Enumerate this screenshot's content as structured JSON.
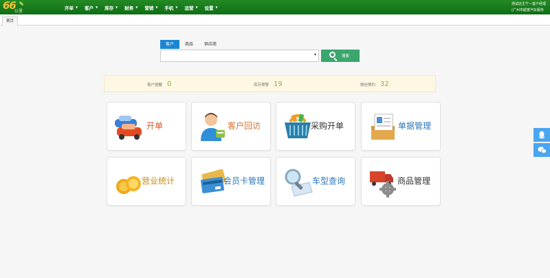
{
  "app": {
    "logo_text": "66",
    "logo_sub": "公里"
  },
  "nav": [
    {
      "label": "开单"
    },
    {
      "label": "客户"
    },
    {
      "label": "库存"
    },
    {
      "label": "财务"
    },
    {
      "label": "营销"
    },
    {
      "label": "手机"
    },
    {
      "label": "运营"
    },
    {
      "label": "设置"
    }
  ],
  "user": {
    "line1": "测试店主宁—客户经理",
    "line2": "(广州市超宽汽车服务"
  },
  "tabs": {
    "home": "首页"
  },
  "search": {
    "tabs": [
      "客户",
      "商品",
      "供应商"
    ],
    "active_tab": "客户",
    "value": "",
    "placeholder": "",
    "button": "搜索"
  },
  "stats": [
    {
      "label": "客户提醒",
      "value": "0"
    },
    {
      "label": "库存预警",
      "value": "19"
    },
    {
      "label": "微信预约",
      "value": "32"
    }
  ],
  "tiles": [
    {
      "label": "开单",
      "icon": "cars-icon",
      "color": "#e0552a"
    },
    {
      "label": "客户回访",
      "icon": "customer-service-icon",
      "color": "#d5712c"
    },
    {
      "label": "采购开单",
      "icon": "shopping-basket-icon",
      "color": "#333333"
    },
    {
      "label": "单据管理",
      "icon": "document-folder-icon",
      "color": "#2e78b7"
    },
    {
      "label": "营业统计",
      "icon": "gold-coins-icon",
      "color": "#c78a16"
    },
    {
      "label": "会员卡管理",
      "icon": "member-card-icon",
      "color": "#2e78b7"
    },
    {
      "label": "车型查询",
      "icon": "magnifier-map-icon",
      "color": "#2e78b7"
    },
    {
      "label": "商品管理",
      "icon": "truck-gear-icon",
      "color": "#333333"
    }
  ],
  "colors": {
    "topbar": "#1a7d1d",
    "accent_blue": "#1b87d3",
    "search_button": "#3ba66e",
    "stat_value": "#8bb33a"
  },
  "side_buttons": [
    {
      "icon": "qq-penguin-icon"
    },
    {
      "icon": "wechat-icon"
    }
  ]
}
